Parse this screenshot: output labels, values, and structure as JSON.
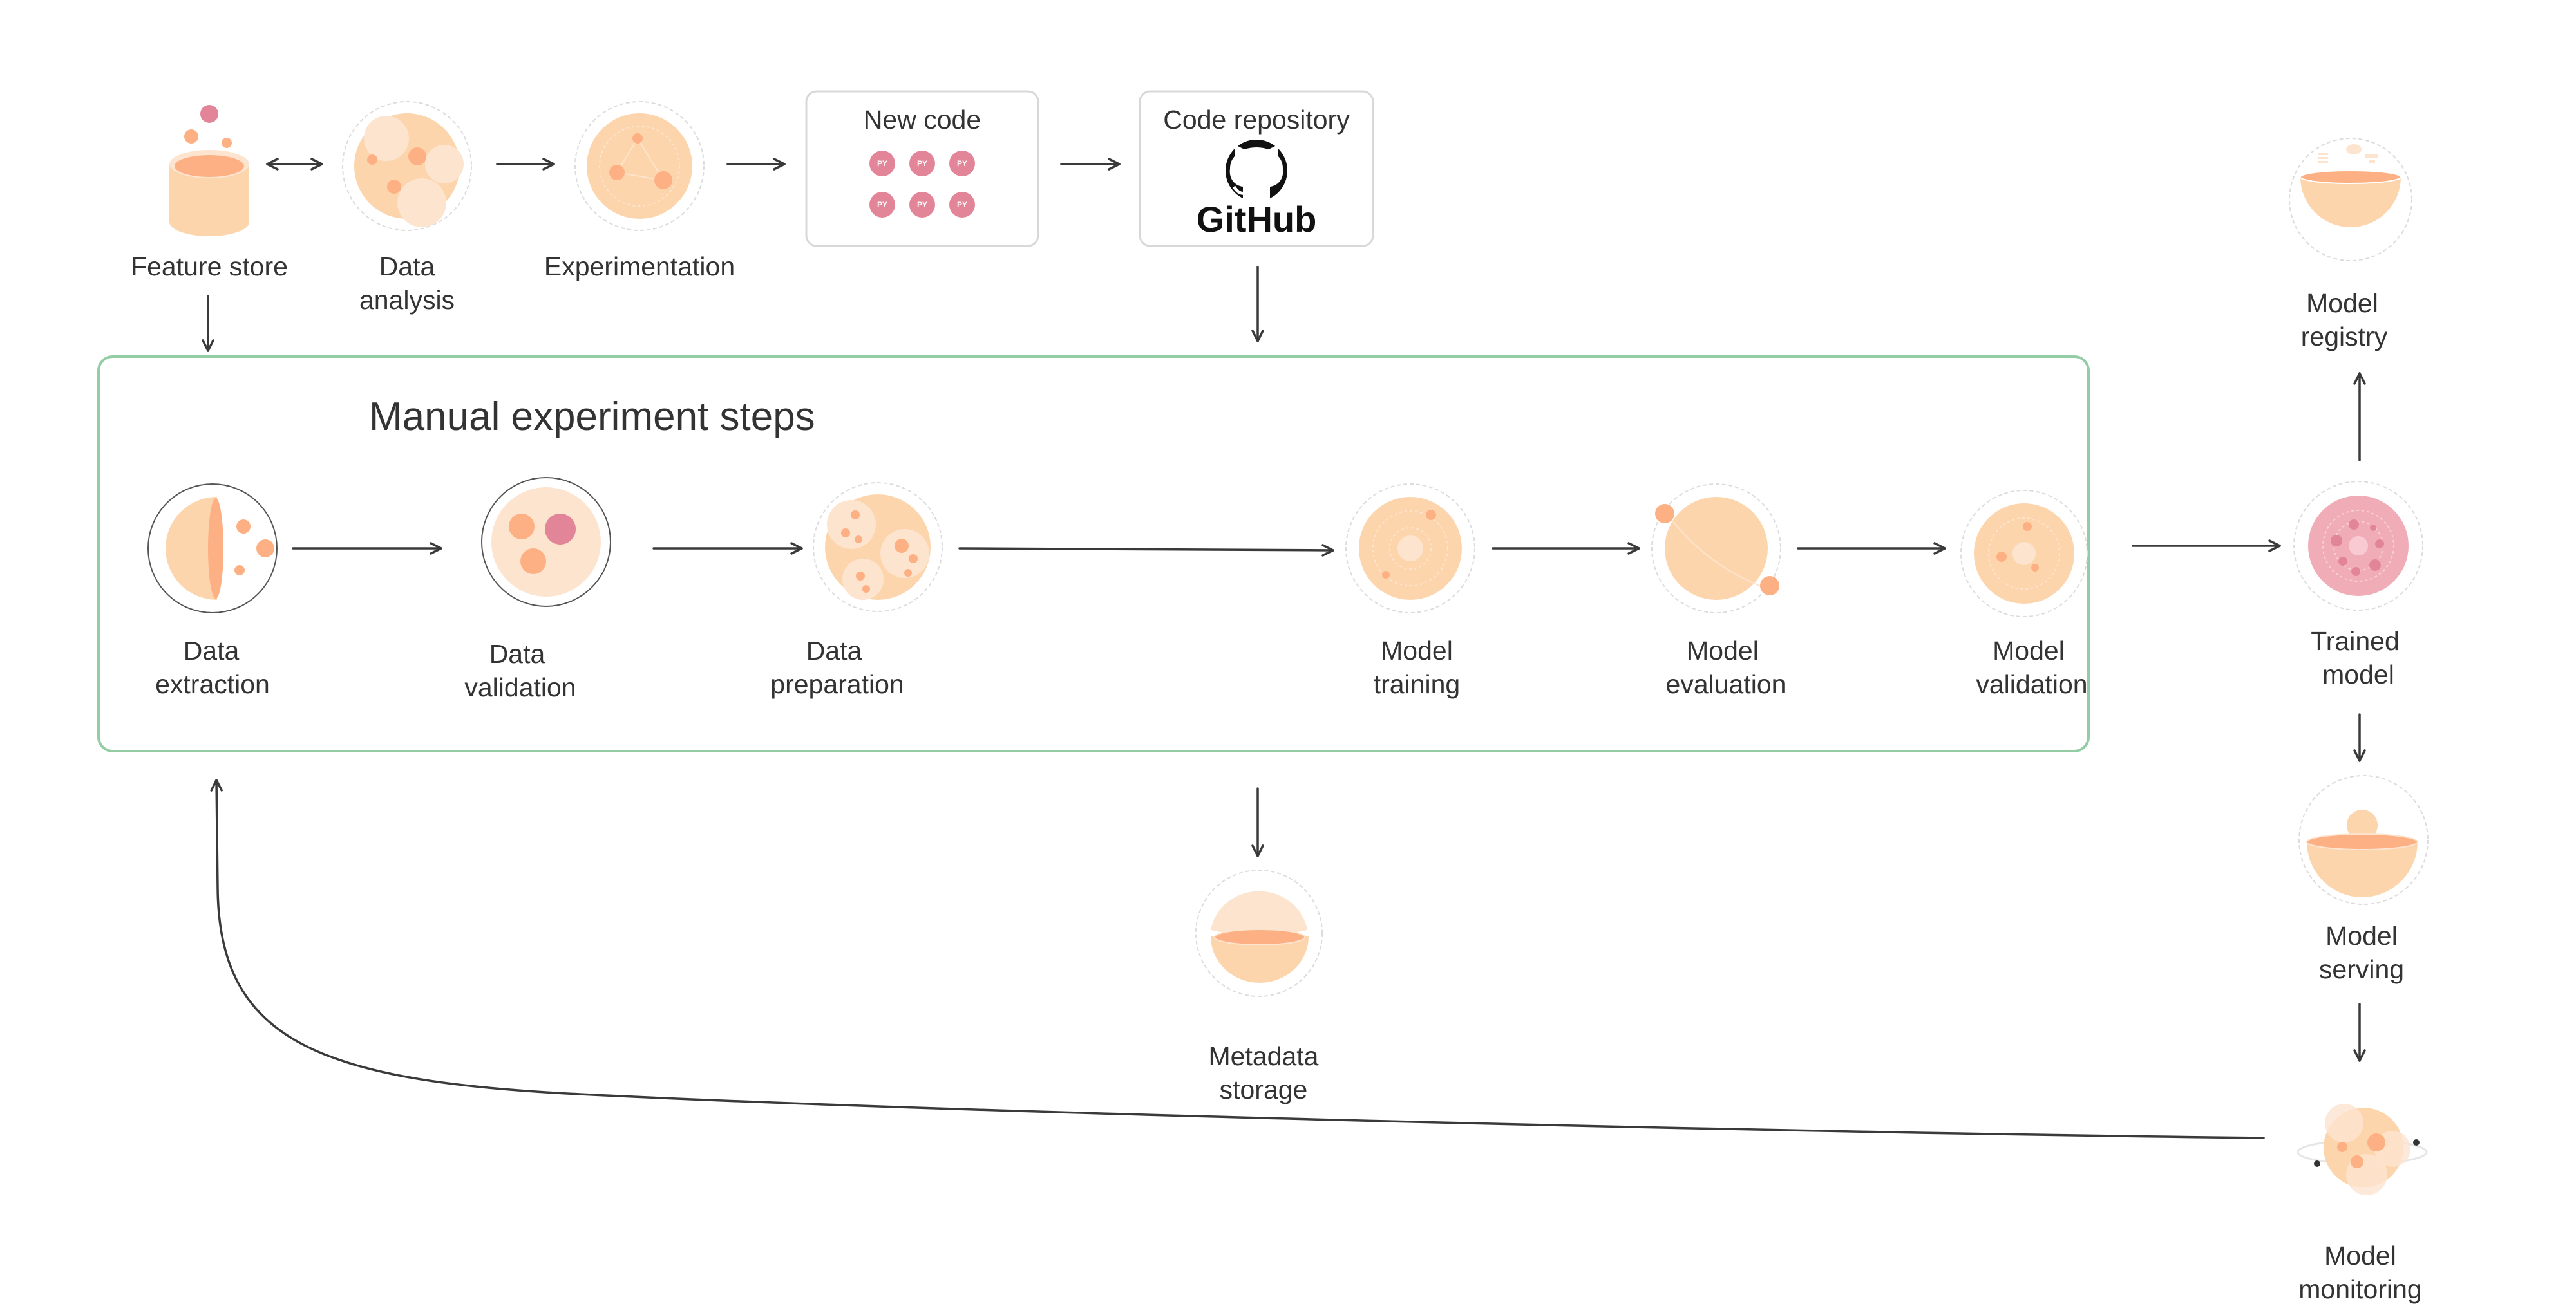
{
  "colors": {
    "peach_light": "#fdd5ad",
    "peach_pale": "#fde4cf",
    "peach_dark": "#fdb083",
    "pink": "#e38598",
    "pink_light": "#f0adb8",
    "group_border": "#94cca5",
    "line": "#3a3a3a"
  },
  "top_row": {
    "feature_store": {
      "label": "Feature store"
    },
    "data_analysis": {
      "label_line1": "Data",
      "label_line2": "analysis"
    },
    "experimentation": {
      "label": "Experimentation"
    },
    "new_code": {
      "title": "New code",
      "file_badges": [
        "PY",
        "PY",
        "PY",
        "PY",
        "PY",
        "PY"
      ]
    },
    "code_repository": {
      "title": "Code repository",
      "logo_text": "GitHub"
    }
  },
  "manual_steps": {
    "title": "Manual experiment steps",
    "steps": [
      {
        "line1": "Data",
        "line2": "extraction"
      },
      {
        "line1": "Data",
        "line2": "validation"
      },
      {
        "line1": "Data",
        "line2": "preparation"
      },
      {
        "line1": "Model",
        "line2": "training"
      },
      {
        "line1": "Model",
        "line2": "evaluation"
      },
      {
        "line1": "Model",
        "line2": "validation"
      }
    ]
  },
  "right_column": {
    "model_registry": {
      "line1": "Model",
      "line2": "registry"
    },
    "trained_model": {
      "line1": "Trained",
      "line2": "model"
    },
    "model_serving": {
      "line1": "Model",
      "line2": "serving"
    },
    "model_monitoring": {
      "line1": "Model",
      "line2": "monitoring"
    }
  },
  "metadata_storage": {
    "line1": "Metadata",
    "line2": "storage"
  }
}
